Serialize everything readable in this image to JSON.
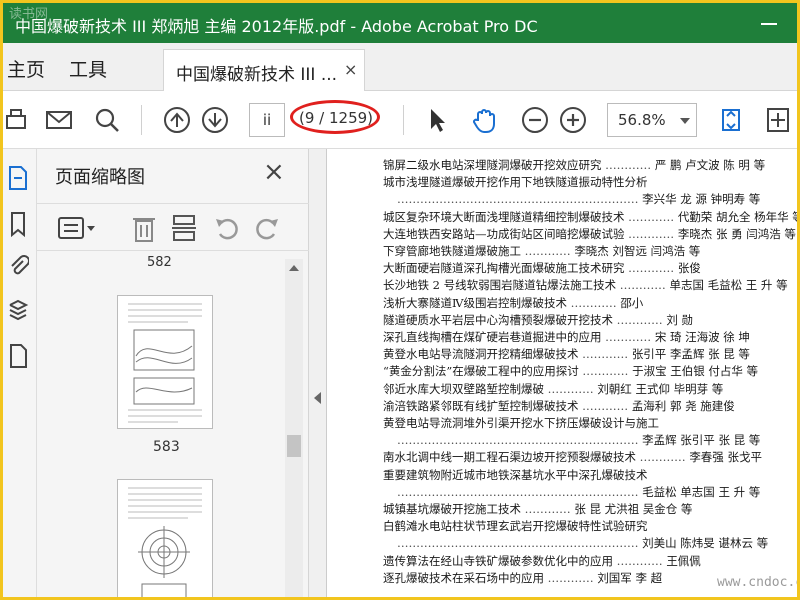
{
  "window": {
    "title": "中国爆破新技术 III 郑炳旭 主编 2012年版.pdf - Adobe Acrobat Pro DC",
    "watermark": "读书网"
  },
  "nav": {
    "home": "主页",
    "tools": "工具"
  },
  "tab": {
    "label": "中国爆破新技术 III ...",
    "close": "×"
  },
  "toolbar": {
    "page_input": "ii",
    "page_count": "(9 / 1259)",
    "zoom": "56.8%"
  },
  "panel": {
    "title": "页面缩略图",
    "close": "×",
    "top_page_label": "582",
    "page_label": "583"
  },
  "toc": [
    {
      "text": "锦屏二级水电站深埋隧洞爆破开挖效应研究",
      "authors": "严  鹏  卢文波  陈  明  等"
    },
    {
      "text": "城市浅埋隧道爆破开挖作用下地铁隧道振动特性分析",
      "authors": ""
    },
    {
      "text": "",
      "authors": "李兴华  龙  源  钟明寿  等"
    },
    {
      "text": "城区复杂环境大断面浅埋隧道精细控制爆破技术",
      "authors": "代勤荣  胡允全  杨年华  等"
    },
    {
      "text": "大连地铁西安路站—功成街站区间暗挖爆破试验",
      "authors": "李晓杰  张  勇  闫鸿浩  等"
    },
    {
      "text": "下穿管廊地铁隧道爆破施工",
      "authors": "李晓杰  刘智远  闫鸿浩  等"
    },
    {
      "text": "大断面硬岩隧道深孔掏槽光面爆破施工技术研究",
      "authors": "张俊"
    },
    {
      "text": "长沙地铁 2 号线软弱围岩隧道钻爆法施工技术",
      "authors": "单志国  毛益松  王  升  等"
    },
    {
      "text": "浅析大寨隧道Ⅳ级围岩控制爆破技术",
      "authors": "邵小"
    },
    {
      "text": "隧道硬质水平岩层中心沟槽预裂爆破开挖技术",
      "authors": "刘  勋"
    },
    {
      "text": "深孔直线掏槽在煤矿硬岩巷道掘进中的应用",
      "authors": "宋  琦  汪海波  徐  坤"
    },
    {
      "text": "黄登水电站导流隧洞开挖精细爆破技术",
      "authors": "张引平  李孟辉  张  昆  等"
    },
    {
      "text": "“黄金分割法”在爆破工程中的应用探讨",
      "authors": "于淑宝  王伯银  付占华  等"
    },
    {
      "text": "邻近水库大坝双壁路堑控制爆破",
      "authors": "刘朝红  王式仰  毕明芽  等"
    },
    {
      "text": "渝涪铁路紧邻既有线扩堑控制爆破技术",
      "authors": "孟海利  郭  尧  施建俊"
    },
    {
      "text": "黄登电站导流洞堆外引渠开挖水下挤压爆破设计与施工",
      "authors": ""
    },
    {
      "text": "",
      "authors": "李孟辉  张引平  张  昆  等"
    },
    {
      "text": "南水北调中线一期工程石渠边坡开挖预裂爆破技术",
      "authors": "李春强  张戈平"
    },
    {
      "text": "重要建筑物附近城市地铁深基坑水平中深孔爆破技术",
      "authors": ""
    },
    {
      "text": "",
      "authors": "毛益松  单志国  王  升  等"
    },
    {
      "text": "城镇基坑爆破开挖施工技术",
      "authors": "张  昆  尤洪祖  吴金仓  等"
    },
    {
      "text": "白鹤滩水电站柱状节理玄武岩开挖爆破特性试验研究",
      "authors": ""
    },
    {
      "text": "",
      "authors": "刘美山  陈炜旻  谌林云  等"
    },
    {
      "text": "遗传算法在经山寺铁矿爆破参数优化中的应用",
      "authors": "王佩佩"
    },
    {
      "text": "逐孔爆破技术在采石场中的应用",
      "authors": "刘国军  李  超"
    }
  ],
  "doc_watermark": "www.cndoc.com"
}
